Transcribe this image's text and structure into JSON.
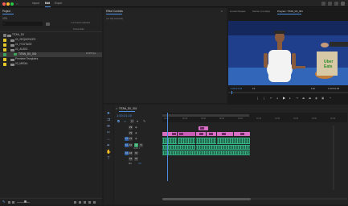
{
  "menu": {
    "home": "Import",
    "edit": "Edit",
    "export": "Export"
  },
  "project": {
    "title": "Project",
    "project_name": "2/31",
    "items_selected": "1 of 6 items selected",
    "frame_rate": "Frame Rate",
    "rows": [
      {
        "name": "TITAN_DX",
        "color": "#7a7a7a",
        "indent": 0,
        "type": "folder"
      },
      {
        "name": "00_SEQUENCES",
        "color": "#e4c72a",
        "indent": 1,
        "type": "folder"
      },
      {
        "name": "01_FOOTAGE",
        "color": "#e4c72a",
        "indent": 1,
        "type": "folder"
      },
      {
        "name": "02_AUDIO",
        "color": "#e4c72a",
        "indent": 1,
        "type": "folder"
      },
      {
        "name": "TITAN_DX_001",
        "color": "#3fa15a",
        "indent": 2,
        "type": "sequence",
        "rate": "23.976 fps"
      },
      {
        "name": "Premiere Templates",
        "color": "#e4c72a",
        "indent": 1,
        "type": "folder"
      },
      {
        "name": "03_MEDIA",
        "color": "#e4c72a",
        "indent": 1,
        "type": "folder"
      }
    ]
  },
  "effect_controls": {
    "title": "Effect Controls",
    "empty": "(no clip selected)"
  },
  "program": {
    "tabs": [
      "Lumetri Scopes",
      "Source: (no clips)",
      "Program: TITAN_DX_001"
    ],
    "timecode": "1:00:21:15",
    "fit": "Fit",
    "quality": "Full",
    "duration": "1:00:52:18",
    "overlay_logo_line1": "Uber",
    "overlay_logo_line2": "Eats"
  },
  "timeline": {
    "seq_tab": "TITAN_DX_001",
    "timecode": "1:00:21:15",
    "track_labels": [
      "V3",
      "V2",
      "V1",
      "A1",
      "A2",
      "A3",
      "Mix"
    ],
    "audio_label": "Audio 1",
    "mix_value": "0.0",
    "ruler_ticks": [
      "00:00",
      "00:15",
      "00:30",
      "00:45",
      "01:00",
      "01:15",
      "01:30",
      "01:45",
      "02:00",
      "02:15"
    ]
  },
  "colors": {
    "accent": "#4d8ee0",
    "video_clip": "#d86fc4",
    "audio_clip": "#33b38a",
    "label": "#e4c72a"
  }
}
